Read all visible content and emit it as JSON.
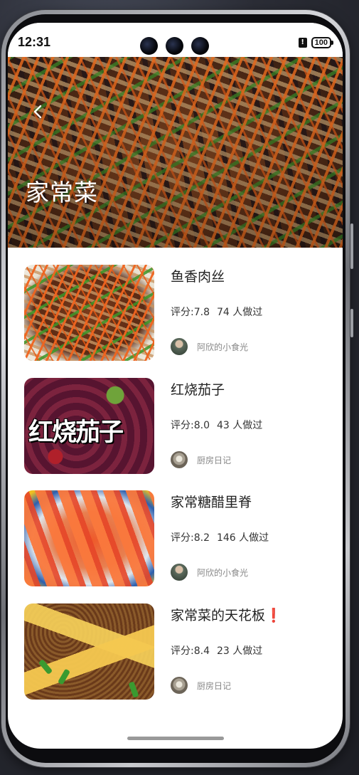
{
  "status_bar": {
    "time": "12:31",
    "battery": "100",
    "alert_symbol": "!"
  },
  "header": {
    "title": "家常菜",
    "back_icon": "chevron-left-icon"
  },
  "recipes": [
    {
      "title": "鱼香肉丝",
      "rating_label": "评分:7.8",
      "made_count": "74 人做过",
      "author": "阿欣的小食光",
      "thumb_text": ""
    },
    {
      "title": "红烧茄子",
      "rating_label": "评分:8.0",
      "made_count": "43 人做过",
      "author": "厨房日记",
      "thumb_text": "红烧茄子"
    },
    {
      "title": "家常糖醋里脊",
      "rating_label": "评分:8.2",
      "made_count": "146 人做过",
      "author": "阿欣的小食光",
      "thumb_text": ""
    },
    {
      "title": "家常菜的天花板❗",
      "rating_label": "评分:8.4",
      "made_count": "23 人做过",
      "author": "厨房日记",
      "thumb_text": ""
    }
  ],
  "colors": {
    "title_text": "#222222",
    "secondary_text": "#888888",
    "background": "#ffffff"
  }
}
